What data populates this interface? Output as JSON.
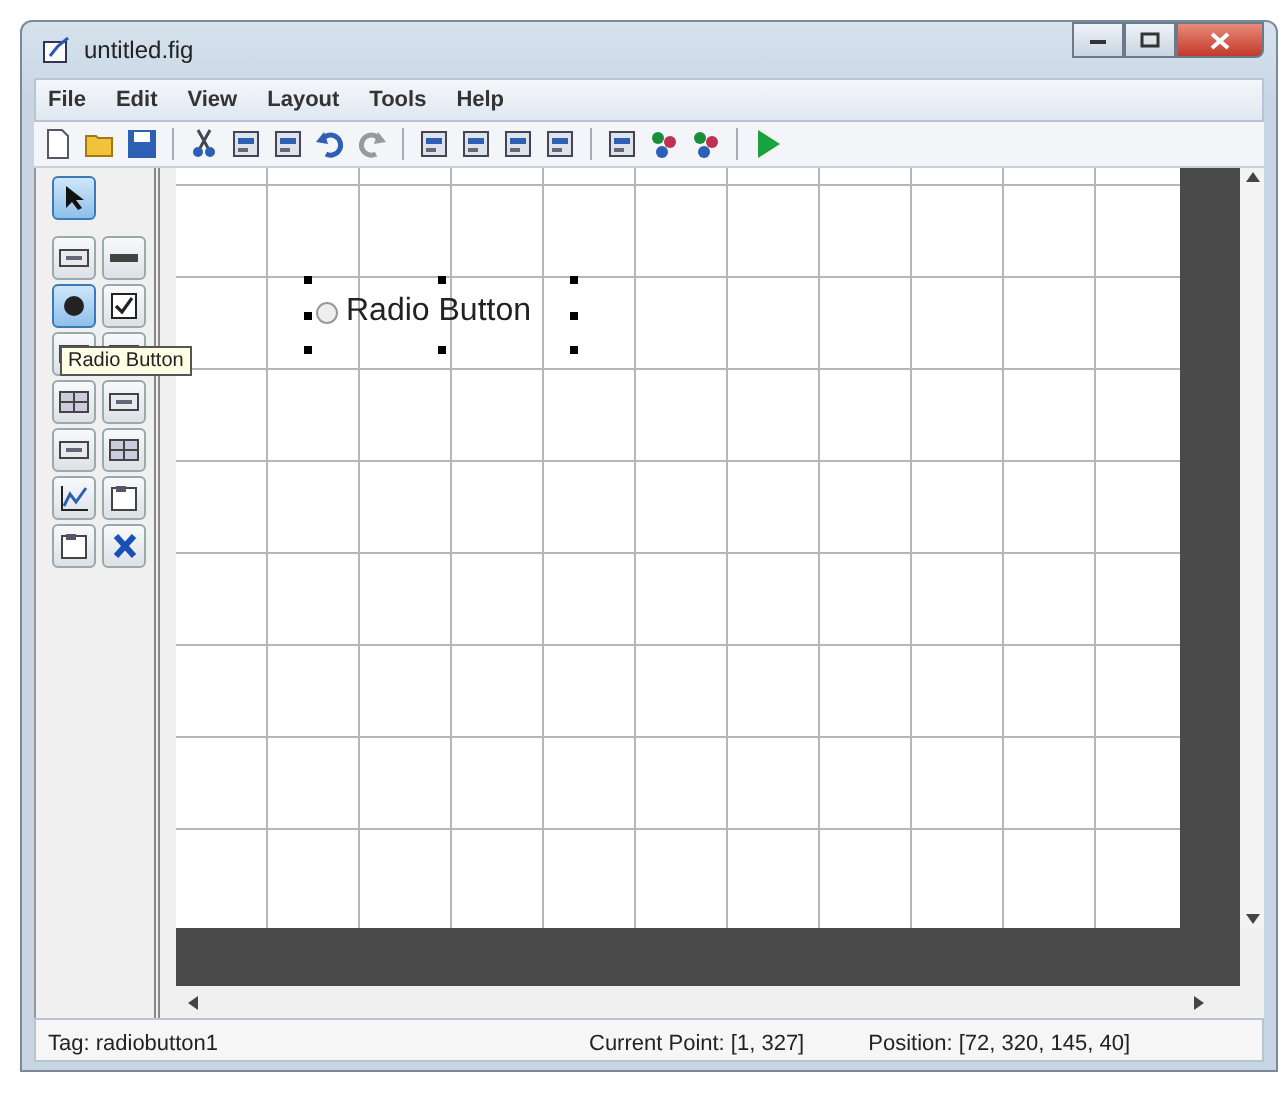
{
  "window": {
    "title": "untitled.fig"
  },
  "menu": [
    "File",
    "Edit",
    "View",
    "Layout",
    "Tools",
    "Help"
  ],
  "palette": [
    {
      "kind": "pointer",
      "selected": true
    },
    {
      "kind": "pushbutton",
      "selected": false
    },
    {
      "kind": "slider",
      "selected": false
    },
    {
      "kind": "radio",
      "selected": true
    },
    {
      "kind": "checkbox",
      "selected": false
    },
    {
      "kind": "edit",
      "selected": false
    },
    {
      "kind": "text",
      "selected": false
    },
    {
      "kind": "popup",
      "selected": false
    },
    {
      "kind": "listbox",
      "selected": false
    },
    {
      "kind": "toggle",
      "selected": false
    },
    {
      "kind": "table",
      "selected": false
    },
    {
      "kind": "axes",
      "selected": false
    },
    {
      "kind": "panel",
      "selected": false
    },
    {
      "kind": "buttongroup",
      "selected": false
    },
    {
      "kind": "activex",
      "selected": false
    }
  ],
  "tooltip": "Radio Button",
  "component": {
    "label": "Radio Button",
    "selected": true,
    "checked": false
  },
  "status_bar": {
    "tag": "Tag: radiobutton1",
    "current_point": "Current Point:  [1, 327]",
    "position": "Position: [72, 320, 145, 40]"
  }
}
